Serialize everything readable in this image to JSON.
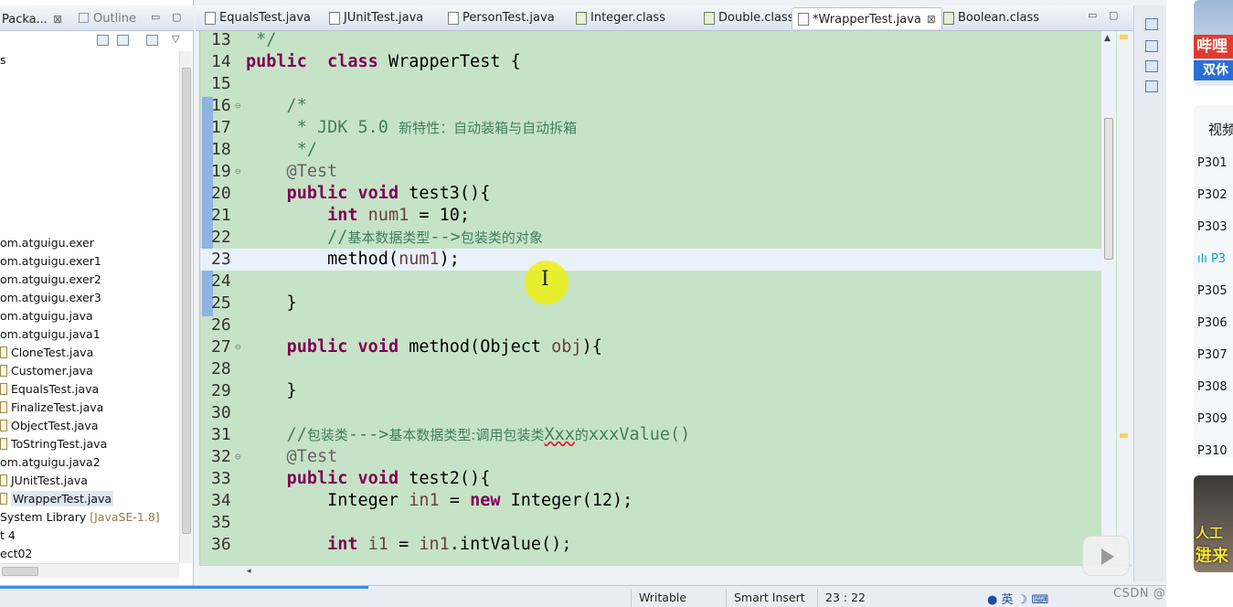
{
  "left_panel": {
    "tab_package": "Packa...",
    "tab_outline": "Outline",
    "tab_close": "⊠",
    "tree_items": [
      {
        "label": "s",
        "icon": false,
        "selected": false
      },
      {
        "label": "om.atguigu.exer",
        "icon": false,
        "selected": false
      },
      {
        "label": "om.atguigu.exer1",
        "icon": false,
        "selected": false
      },
      {
        "label": "om.atguigu.exer2",
        "icon": false,
        "selected": false
      },
      {
        "label": "om.atguigu.exer3",
        "icon": false,
        "selected": false
      },
      {
        "label": "om.atguigu.java",
        "icon": false,
        "selected": false
      },
      {
        "label": "om.atguigu.java1",
        "icon": false,
        "selected": false
      },
      {
        "label": "CloneTest.java",
        "icon": true,
        "selected": false
      },
      {
        "label": "Customer.java",
        "icon": true,
        "selected": false
      },
      {
        "label": "EqualsTest.java",
        "icon": true,
        "selected": false
      },
      {
        "label": "FinalizeTest.java",
        "icon": true,
        "selected": false
      },
      {
        "label": "ObjectTest.java",
        "icon": true,
        "selected": false
      },
      {
        "label": "ToStringTest.java",
        "icon": true,
        "selected": false
      },
      {
        "label": "om.atguigu.java2",
        "icon": false,
        "selected": false
      },
      {
        "label": "JUnitTest.java",
        "icon": true,
        "selected": false
      },
      {
        "label": "WrapperTest.java",
        "icon": true,
        "selected": true
      },
      {
        "label": "System Library ",
        "hint": "[JavaSE-1.8]",
        "icon": false,
        "selected": false
      },
      {
        "label": "t 4",
        "icon": false,
        "selected": false
      },
      {
        "label": "ect02",
        "icon": false,
        "selected": false
      }
    ]
  },
  "editor_tabs": [
    {
      "label": "EqualsTest.java",
      "kind": "java",
      "active": false
    },
    {
      "label": "JUnitTest.java",
      "kind": "java",
      "active": false
    },
    {
      "label": "PersonTest.java",
      "kind": "java",
      "active": false
    },
    {
      "label": "Integer.class",
      "kind": "class",
      "active": false
    },
    {
      "label": "Double.class",
      "kind": "class",
      "active": false
    },
    {
      "label": "*WrapperTest.java",
      "kind": "java",
      "active": true
    },
    {
      "label": "Boolean.class",
      "kind": "class",
      "active": false
    }
  ],
  "code_lines": [
    {
      "n": "13",
      "fold": "",
      "html": " */",
      "cls": "cm"
    },
    {
      "n": "14",
      "fold": "",
      "parts": [
        [
          "kw",
          "public"
        ],
        [
          "",
          "  "
        ],
        [
          "kw",
          "class"
        ],
        [
          "",
          " WrapperTest {"
        ]
      ]
    },
    {
      "n": "15",
      "fold": "",
      "parts": [
        [
          "",
          ""
        ]
      ]
    },
    {
      "n": "16",
      "fold": "⊖",
      "parts": [
        [
          "cm",
          "    /*"
        ]
      ]
    },
    {
      "n": "17",
      "fold": "",
      "parts": [
        [
          "cm",
          "     * JDK 5.0 "
        ],
        [
          "cn",
          "新特性：自动装箱与自动拆箱"
        ]
      ]
    },
    {
      "n": "18",
      "fold": "",
      "parts": [
        [
          "cm",
          "     */"
        ]
      ]
    },
    {
      "n": "19",
      "fold": "⊖",
      "parts": [
        [
          "an",
          "    @Test"
        ]
      ]
    },
    {
      "n": "20",
      "fold": "",
      "parts": [
        [
          "",
          "    "
        ],
        [
          "kw",
          "public"
        ],
        [
          "",
          " "
        ],
        [
          "kw",
          "void"
        ],
        [
          "",
          " test3(){"
        ]
      ]
    },
    {
      "n": "21",
      "fold": "",
      "parts": [
        [
          "",
          "        "
        ],
        [
          "kw",
          "int"
        ],
        [
          "",
          " "
        ],
        [
          "var",
          "num1"
        ],
        [
          "",
          " = 10;"
        ]
      ]
    },
    {
      "n": "22",
      "fold": "",
      "parts": [
        [
          "cm",
          "        //"
        ],
        [
          "cn",
          "基本数据类型"
        ],
        [
          "cm",
          "-->"
        ],
        [
          "cn",
          "包装类的对象"
        ]
      ]
    },
    {
      "n": "23",
      "fold": "",
      "parts": [
        [
          "",
          "        method("
        ],
        [
          "var",
          "num1"
        ],
        [
          "",
          ");"
        ]
      ],
      "current": true
    },
    {
      "n": "24",
      "fold": "",
      "parts": [
        [
          "",
          ""
        ]
      ]
    },
    {
      "n": "25",
      "fold": "",
      "parts": [
        [
          "",
          "    }"
        ]
      ]
    },
    {
      "n": "26",
      "fold": "",
      "parts": [
        [
          "",
          ""
        ]
      ]
    },
    {
      "n": "27",
      "fold": "⊖",
      "parts": [
        [
          "",
          "    "
        ],
        [
          "kw",
          "public"
        ],
        [
          "",
          " "
        ],
        [
          "kw",
          "void"
        ],
        [
          "",
          " method(Object "
        ],
        [
          "var",
          "obj"
        ],
        [
          "",
          "){"
        ]
      ]
    },
    {
      "n": "28",
      "fold": "",
      "parts": [
        [
          "",
          ""
        ]
      ]
    },
    {
      "n": "29",
      "fold": "",
      "parts": [
        [
          "",
          "    }"
        ]
      ]
    },
    {
      "n": "30",
      "fold": "",
      "parts": [
        [
          "",
          ""
        ]
      ]
    },
    {
      "n": "31",
      "fold": "",
      "parts": [
        [
          "cm",
          "    //"
        ],
        [
          "cn",
          "包装类"
        ],
        [
          "cm",
          "--->"
        ],
        [
          "cn",
          "基本数据类型:调用包装类"
        ],
        [
          "cm sq",
          "Xxx"
        ],
        [
          "cn",
          "的"
        ],
        [
          "cm",
          "xxxValue()"
        ]
      ]
    },
    {
      "n": "32",
      "fold": "⊖",
      "parts": [
        [
          "an",
          "    @Test"
        ]
      ]
    },
    {
      "n": "33",
      "fold": "",
      "parts": [
        [
          "",
          "    "
        ],
        [
          "kw",
          "public"
        ],
        [
          "",
          " "
        ],
        [
          "kw",
          "void"
        ],
        [
          "",
          " test2(){"
        ]
      ]
    },
    {
      "n": "34",
      "fold": "",
      "parts": [
        [
          "",
          "        Integer "
        ],
        [
          "var",
          "in1"
        ],
        [
          "",
          " = "
        ],
        [
          "kw",
          "new"
        ],
        [
          "",
          " Integer(12);"
        ]
      ]
    },
    {
      "n": "35",
      "fold": "",
      "parts": [
        [
          "",
          ""
        ]
      ]
    },
    {
      "n": "36",
      "fold": "",
      "parts": [
        [
          "",
          "        "
        ],
        [
          "kw",
          "int"
        ],
        [
          "",
          " "
        ],
        [
          "var",
          "i1"
        ],
        [
          "",
          " = "
        ],
        [
          "var",
          "in1"
        ],
        [
          "",
          ".intValue();"
        ]
      ]
    }
  ],
  "status": {
    "writable": "Writable",
    "insert_mode": "Smart Insert",
    "position": "23 : 22",
    "tray": "英",
    "load_progress": 0.31
  },
  "watermark": "CSDN @叮当！*",
  "bili": {
    "thumb_top_red": "哔哩",
    "thumb_top_blue": "双休",
    "playlist_title": "视频",
    "playlist_items": [
      {
        "label": "P301",
        "active": false
      },
      {
        "label": "P302",
        "active": false
      },
      {
        "label": "P303",
        "active": false
      },
      {
        "label": "P3",
        "active": true
      },
      {
        "label": "P305",
        "active": false
      },
      {
        "label": "P306",
        "active": false
      },
      {
        "label": "P307",
        "active": false
      },
      {
        "label": "P308",
        "active": false
      },
      {
        "label": "P309",
        "active": false
      },
      {
        "label": "P310",
        "active": false
      }
    ],
    "thumb_bottom_line1": "人工智",
    "thumb_bottom_line2": "进来"
  },
  "colors": {
    "editor_bg": "#c7e3c7",
    "keyword": "#7f0055",
    "comment": "#3f7f5f",
    "current_line": "#e9f1fa",
    "cursor_highlight": "#ebf014"
  }
}
